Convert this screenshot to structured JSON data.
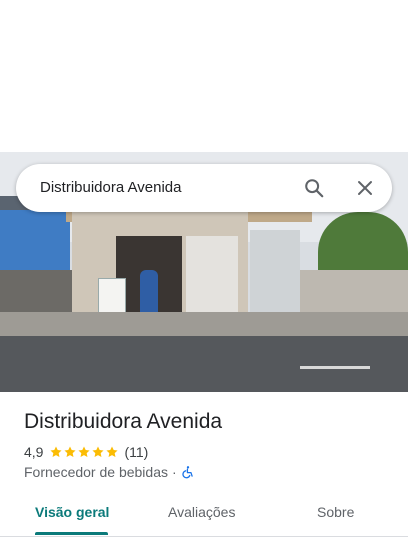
{
  "search": {
    "query": "Distribuidora Avenida"
  },
  "icons": {
    "search": "search-icon",
    "close": "close-icon",
    "accessibility": "wheelchair-icon",
    "star": "star-icon"
  },
  "place": {
    "name": "Distribuidora Avenida",
    "rating": "4,9",
    "stars": 5,
    "review_count": "(11)",
    "category": "Fornecedor de bebidas",
    "separator": "·"
  },
  "tabs": [
    {
      "label": "Visão geral",
      "active": true
    },
    {
      "label": "Avaliações",
      "active": false
    },
    {
      "label": "Sobre",
      "active": false
    }
  ],
  "colors": {
    "accent": "#0b7a7a",
    "star": "#fbbc04",
    "accessibility": "#1a73e8"
  }
}
